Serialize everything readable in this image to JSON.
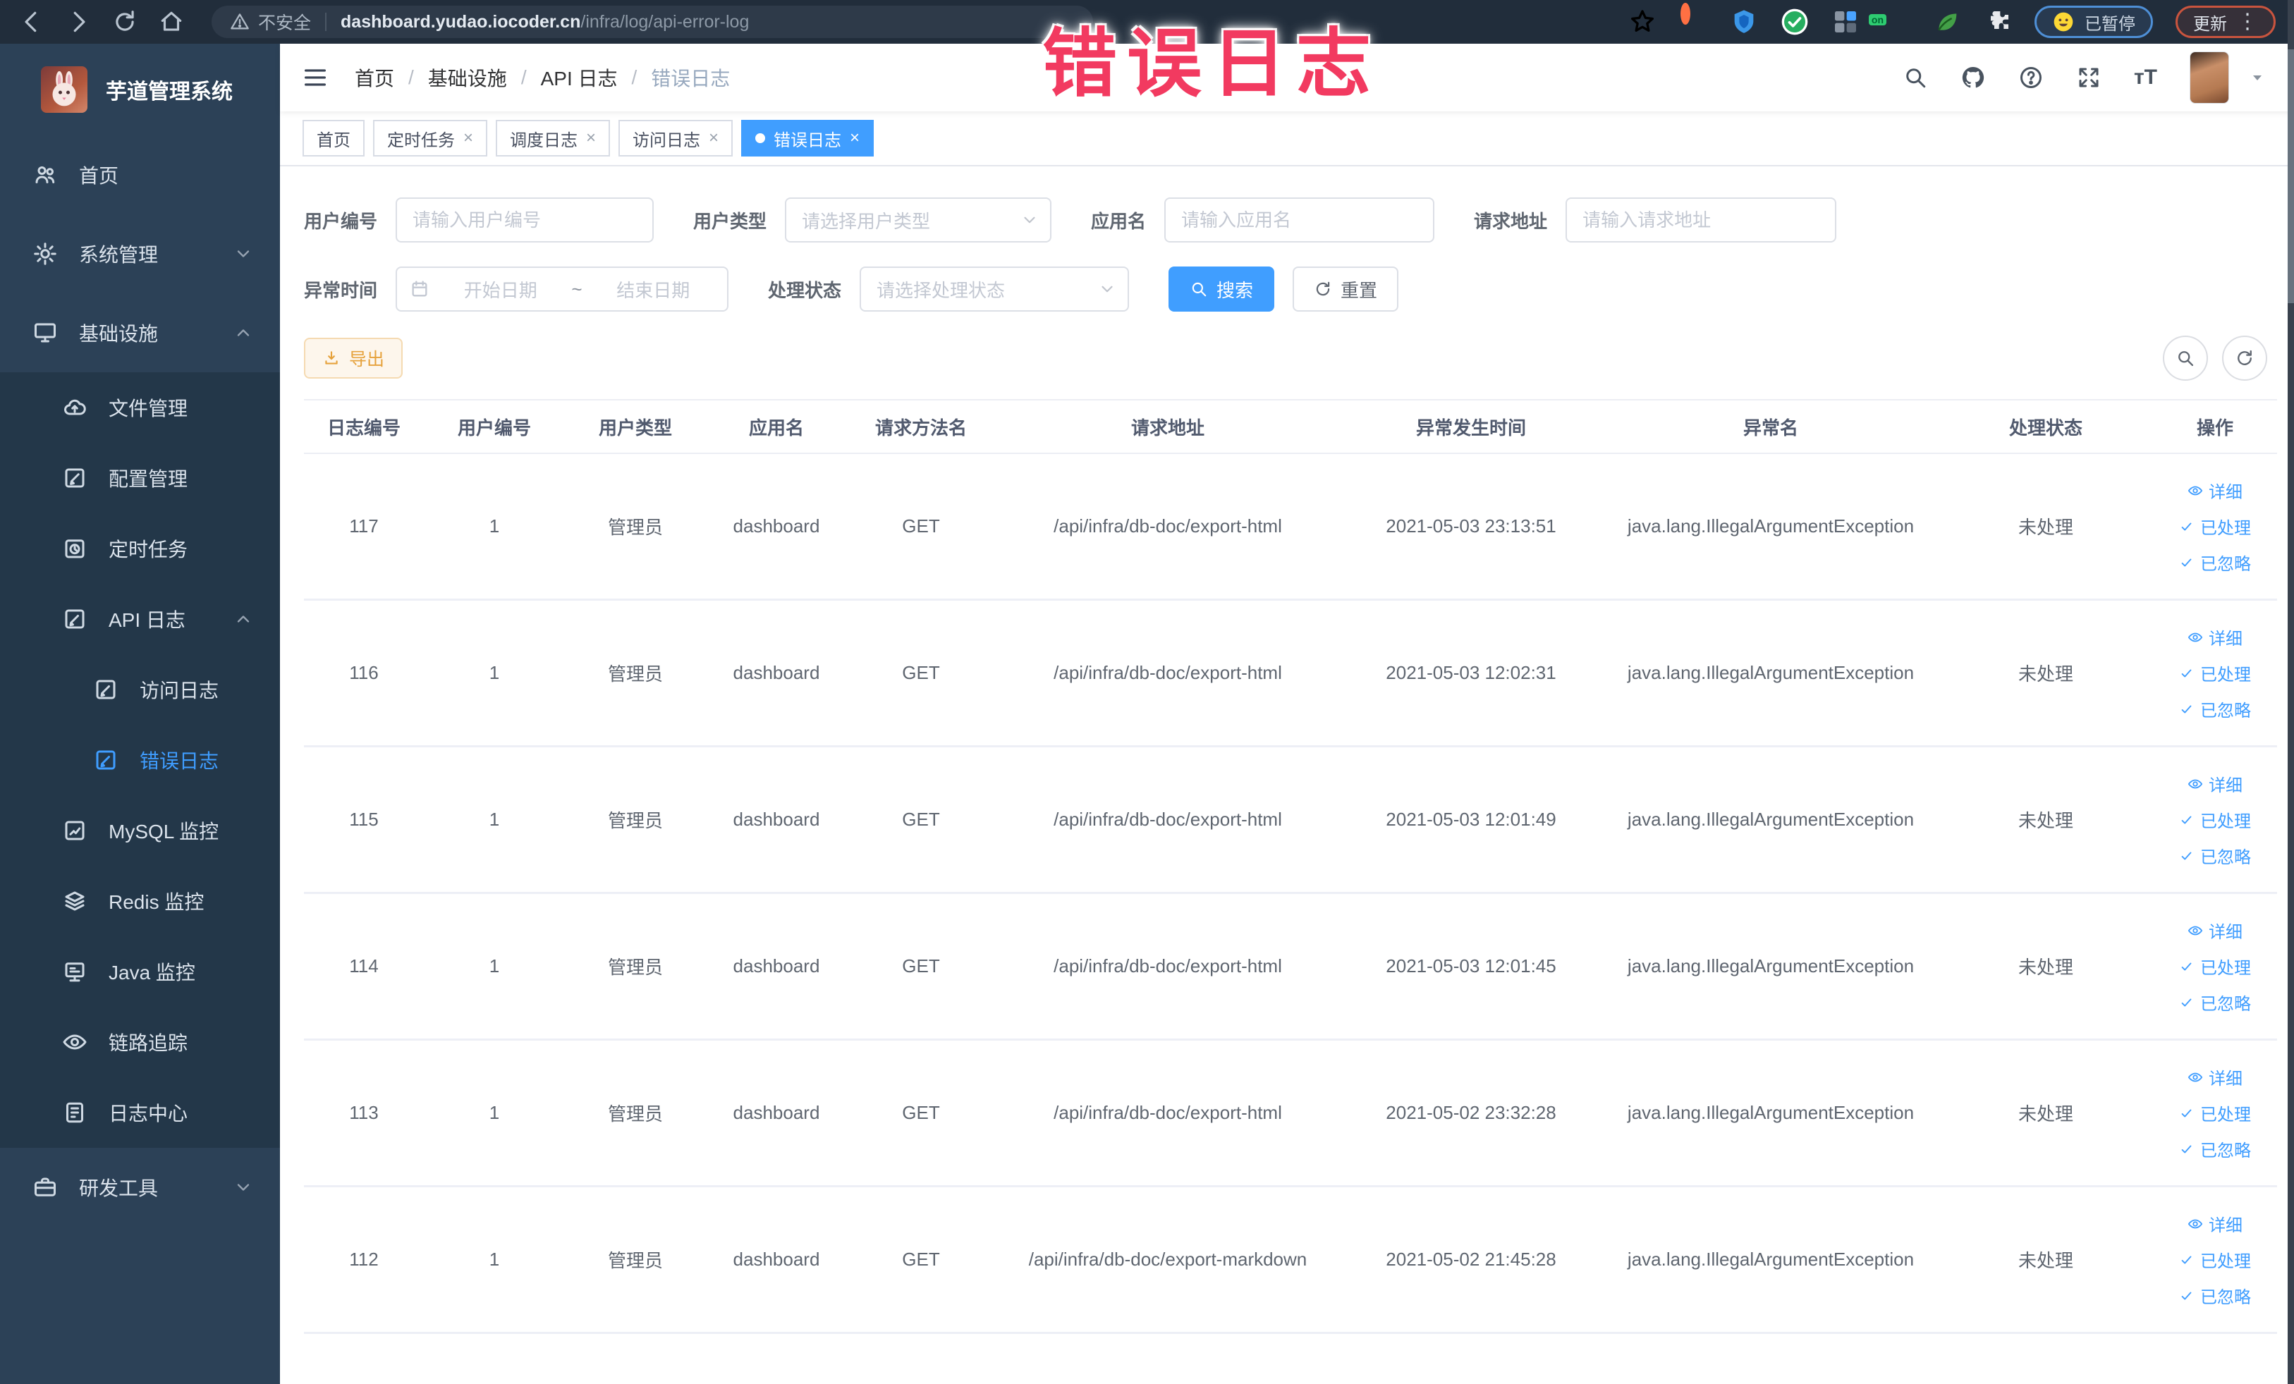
{
  "colors": {
    "accent": "#409eff",
    "warning": "#e6a23c",
    "watermark": "#f23a60",
    "sidebar_bg": "#2c4157",
    "submenu_bg": "#233749",
    "chrome_bg": "#212d3b"
  },
  "watermark": "错误日志",
  "browser": {
    "nav_icons": [
      "back-icon",
      "forward-icon",
      "reload-icon",
      "home-icon"
    ],
    "security_label": "不安全",
    "url_domain": "dashboard.yudao.iocoder.cn",
    "url_path": "/infra/log/api-error-log",
    "bookmark_icon": "star-icon",
    "extension_icons": [
      "ext-orange-ring-icon",
      "ext-blue-shield-icon",
      "ext-green-check-icon",
      "ext-grid-icon",
      "ext-on-badge-icon",
      "ext-leaf-icon",
      "extensions-puzzle-icon"
    ],
    "paused_badge": "已暂停",
    "update_button": "更新",
    "menu_dots": "⋮"
  },
  "sidebar": {
    "app_title": "芋道管理系统",
    "items": [
      {
        "id": "home",
        "label": "首页",
        "icon": "people",
        "level": 0
      },
      {
        "id": "system-management",
        "label": "系统管理",
        "icon": "gear",
        "level": 0,
        "chevron": "down"
      },
      {
        "id": "infrastructure",
        "label": "基础设施",
        "icon": "monitor",
        "level": 0,
        "chevron": "up"
      },
      {
        "id": "file-management",
        "label": "文件管理",
        "icon": "cloud",
        "level": 1
      },
      {
        "id": "config-management",
        "label": "配置管理",
        "icon": "pencil",
        "level": 1
      },
      {
        "id": "scheduled-tasks",
        "label": "定时任务",
        "icon": "timer",
        "level": 1
      },
      {
        "id": "api-log",
        "label": "API 日志",
        "icon": "log",
        "level": 1,
        "chevron": "up"
      },
      {
        "id": "access-log",
        "label": "访问日志",
        "icon": "log",
        "level": 2
      },
      {
        "id": "error-log",
        "label": "错误日志",
        "icon": "log",
        "level": 2,
        "active": true
      },
      {
        "id": "mysql-monitor",
        "label": "MySQL 监控",
        "icon": "chart",
        "level": 1
      },
      {
        "id": "redis-monitor",
        "label": "Redis 监控",
        "icon": "layers",
        "level": 1
      },
      {
        "id": "java-monitor",
        "label": "Java 监控",
        "icon": "javamon",
        "level": 1
      },
      {
        "id": "trace",
        "label": "链路追踪",
        "icon": "eye",
        "level": 1
      },
      {
        "id": "log-center",
        "label": "日志中心",
        "icon": "doc",
        "level": 1
      },
      {
        "id": "dev-tools",
        "label": "研发工具",
        "icon": "briefcase",
        "level": 0,
        "chevron": "down"
      }
    ]
  },
  "header": {
    "breadcrumb": [
      "首页",
      "基础设施",
      "API 日志",
      "错误日志"
    ],
    "right_icons": [
      "search-icon",
      "github-icon",
      "help-icon",
      "fullscreen-icon",
      "font-size-icon",
      "avatar",
      "caret-down-icon"
    ],
    "font_size_icon_text": "тT"
  },
  "tags": [
    {
      "label": "首页",
      "closable": false,
      "active": false
    },
    {
      "label": "定时任务",
      "closable": true,
      "active": false
    },
    {
      "label": "调度日志",
      "closable": true,
      "active": false
    },
    {
      "label": "访问日志",
      "closable": true,
      "active": false
    },
    {
      "label": "错误日志",
      "closable": true,
      "active": true
    }
  ],
  "filters": {
    "user_no": {
      "label": "用户编号",
      "placeholder": "请输入用户编号"
    },
    "user_type": {
      "label": "用户类型",
      "placeholder": "请选择用户类型"
    },
    "app_name": {
      "label": "应用名",
      "placeholder": "请输入应用名"
    },
    "request_url": {
      "label": "请求地址",
      "placeholder": "请输入请求地址"
    },
    "exception_time": {
      "label": "异常时间",
      "start_placeholder": "开始日期",
      "separator": "~",
      "end_placeholder": "结束日期"
    },
    "process_status": {
      "label": "处理状态",
      "placeholder": "请选择处理状态"
    },
    "search_label": "搜索",
    "reset_label": "重置"
  },
  "toolbar": {
    "export_label": "导出"
  },
  "table": {
    "headers": [
      "日志编号",
      "用户编号",
      "用户类型",
      "应用名",
      "请求方法名",
      "请求地址",
      "异常发生时间",
      "异常名",
      "处理状态",
      "操作"
    ],
    "row_actions": [
      "详细",
      "已处理",
      "已忽略"
    ],
    "rows": [
      {
        "log_id": "117",
        "user_id": "1",
        "user_type": "管理员",
        "app_name": "dashboard",
        "method": "GET",
        "url": "/api/infra/db-doc/export-html",
        "time": "2021-05-03 23:13:51",
        "exception": "java.lang.IllegalArgumentException",
        "status": "未处理"
      },
      {
        "log_id": "116",
        "user_id": "1",
        "user_type": "管理员",
        "app_name": "dashboard",
        "method": "GET",
        "url": "/api/infra/db-doc/export-html",
        "time": "2021-05-03 12:02:31",
        "exception": "java.lang.IllegalArgumentException",
        "status": "未处理"
      },
      {
        "log_id": "115",
        "user_id": "1",
        "user_type": "管理员",
        "app_name": "dashboard",
        "method": "GET",
        "url": "/api/infra/db-doc/export-html",
        "time": "2021-05-03 12:01:49",
        "exception": "java.lang.IllegalArgumentException",
        "status": "未处理"
      },
      {
        "log_id": "114",
        "user_id": "1",
        "user_type": "管理员",
        "app_name": "dashboard",
        "method": "GET",
        "url": "/api/infra/db-doc/export-html",
        "time": "2021-05-03 12:01:45",
        "exception": "java.lang.IllegalArgumentException",
        "status": "未处理"
      },
      {
        "log_id": "113",
        "user_id": "1",
        "user_type": "管理员",
        "app_name": "dashboard",
        "method": "GET",
        "url": "/api/infra/db-doc/export-html",
        "time": "2021-05-02 23:32:28",
        "exception": "java.lang.IllegalArgumentException",
        "status": "未处理"
      },
      {
        "log_id": "112",
        "user_id": "1",
        "user_type": "管理员",
        "app_name": "dashboard",
        "method": "GET",
        "url": "/api/infra/db-doc/export-markdown",
        "time": "2021-05-02 21:45:28",
        "exception": "java.lang.IllegalArgumentException",
        "status": "未处理"
      }
    ]
  }
}
